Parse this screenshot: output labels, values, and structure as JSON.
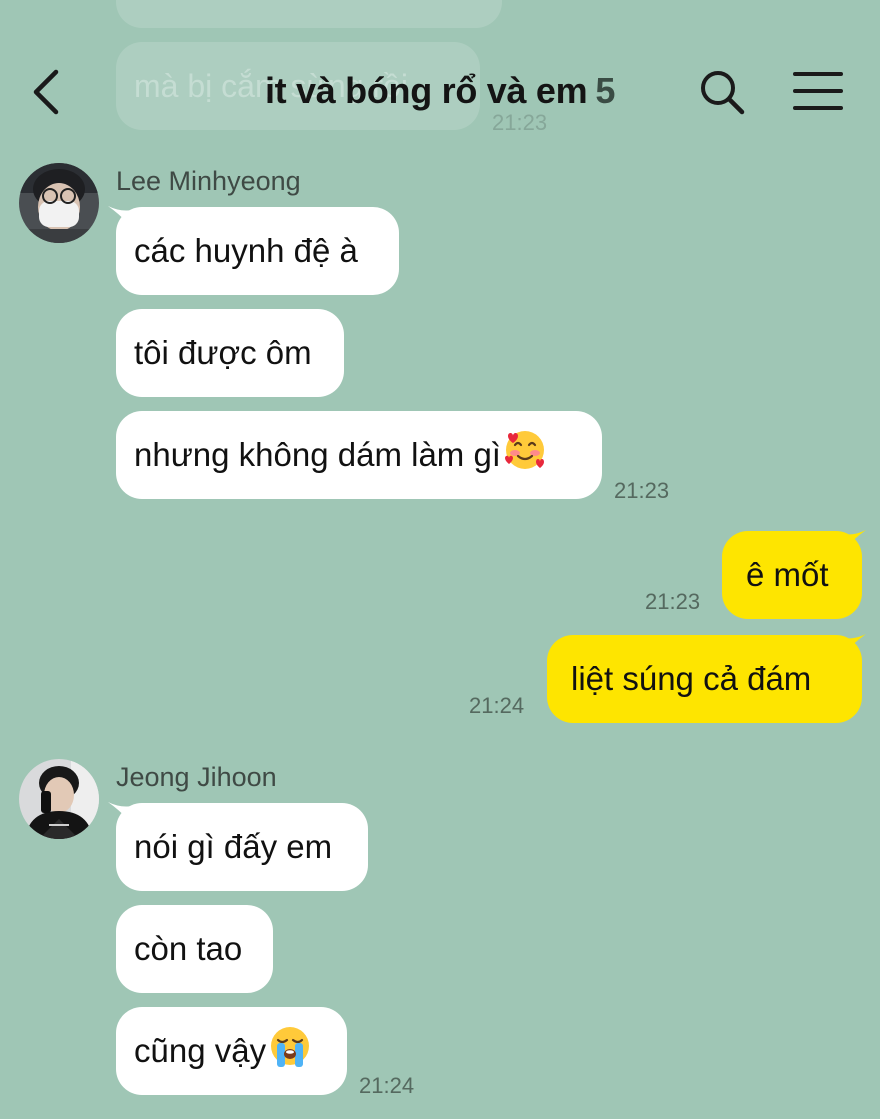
{
  "chat": {
    "title": "it và bóng rổ và em",
    "member_count": "5",
    "faded_message": "mà bị cắm sừng rồi",
    "faded_time": "21:23"
  },
  "groups": [
    {
      "sender": "Lee Minhyeong",
      "messages": [
        "các huynh đệ à",
        "tôi được ôm",
        "nhưng không dám làm gì"
      ],
      "time": "21:23",
      "emoji": "smiling-face-with-hearts"
    },
    {
      "sender": "Jeong Jihoon",
      "messages": [
        "nói gì đấy em",
        "còn tao",
        "cũng vậy"
      ],
      "time": "21:24",
      "emoji": "loudly-crying-face"
    }
  ],
  "mine": [
    {
      "text": "ê mốt",
      "time": "21:23"
    },
    {
      "text": "liệt súng cả đám",
      "time": "21:24"
    }
  ],
  "icons": {
    "back": "chevron-left-icon",
    "search": "search-icon",
    "menu": "hamburger-menu-icon"
  },
  "colors": {
    "background": "#9fc6b5",
    "incoming_bubble": "#ffffff",
    "outgoing_bubble": "#fee500"
  }
}
